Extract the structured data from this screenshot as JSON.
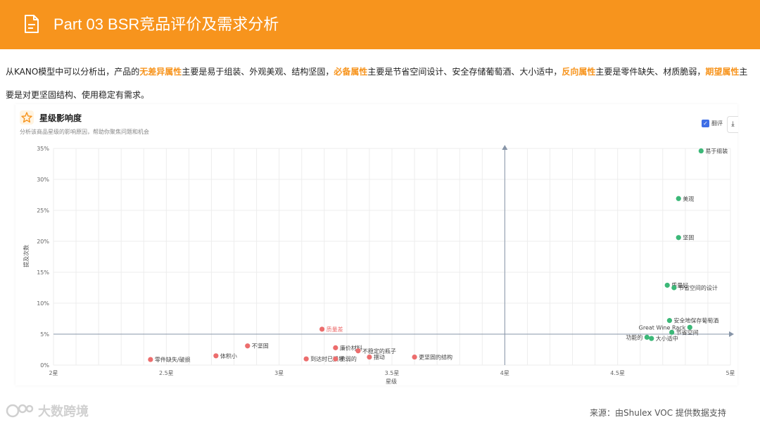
{
  "header": {
    "title": "Part 03  BSR竞品评价及需求分析"
  },
  "description": {
    "p1": "从KANO模型中可以分析出，产品的",
    "h1": "无差异属性",
    "p2": "主要是易于组装、外观美观、结构坚固，",
    "h2": "必备属性",
    "p3": "主要是节省空间设计、安全存储葡萄酒、大小适中，",
    "h3": "反向属性",
    "p4": "主要是零件缺失、材质脆弱，",
    "h4": "期望属性",
    "p5": "主要是对更坚固结构、使用稳定有需求。"
  },
  "panel": {
    "title": "星级影响度",
    "subtitle": "分析该商品星级的影响原因，帮助你聚焦问题和机会",
    "toggle_label": "翻评",
    "star_icon": "star-icon",
    "download_icon": "download-icon"
  },
  "chart_data": {
    "type": "scatter",
    "xlabel": "星级",
    "ylabel": "提及次数",
    "xlim": [
      2,
      5
    ],
    "ylim": [
      0,
      35
    ],
    "x_ticks": [
      "2星",
      "2.5星",
      "3星",
      "3.5星",
      "4星",
      "4.5星",
      "5星"
    ],
    "y_ticks": [
      "0%",
      "5%",
      "10%",
      "15%",
      "20%",
      "25%",
      "30%",
      "35%"
    ],
    "quadrant_center": {
      "x": 4,
      "y": 5
    },
    "colors": {
      "positive": "#3cb878",
      "negative": "#ec6d6d"
    },
    "points": [
      {
        "label": "易于组装",
        "x": 4.87,
        "y": 34.6,
        "group": "positive"
      },
      {
        "label": "美观",
        "x": 4.77,
        "y": 26.9,
        "group": "positive"
      },
      {
        "label": "坚固",
        "x": 4.77,
        "y": 20.6,
        "group": "positive"
      },
      {
        "label": "质量好",
        "x": 4.72,
        "y": 12.9,
        "group": "positive"
      },
      {
        "label": "节省空间的设计",
        "x": 4.75,
        "y": 12.5,
        "group": "positive"
      },
      {
        "label": "安全地保存葡萄酒",
        "x": 4.73,
        "y": 7.2,
        "group": "positive"
      },
      {
        "label": "Great Wine Rack",
        "x": 4.82,
        "y": 6.1,
        "group": "positive"
      },
      {
        "label": "节省空间",
        "x": 4.74,
        "y": 5.3,
        "group": "positive"
      },
      {
        "label": "功能的",
        "x": 4.63,
        "y": 4.5,
        "group": "positive"
      },
      {
        "label": "大小适中",
        "x": 4.65,
        "y": 4.3,
        "group": "positive"
      },
      {
        "label": "质量差",
        "x": 3.19,
        "y": 5.8,
        "group": "negative"
      },
      {
        "label": "不坚固",
        "x": 2.86,
        "y": 3.1,
        "group": "negative"
      },
      {
        "label": "体积小",
        "x": 2.72,
        "y": 1.5,
        "group": "negative"
      },
      {
        "label": "零件缺失/破损",
        "x": 2.43,
        "y": 0.9,
        "group": "negative"
      },
      {
        "label": "到达时已损坏",
        "x": 3.12,
        "y": 1.0,
        "group": "negative"
      },
      {
        "label": "廉价材料",
        "x": 3.25,
        "y": 2.8,
        "group": "negative"
      },
      {
        "label": "不稳定的瓶子",
        "x": 3.35,
        "y": 2.3,
        "group": "negative"
      },
      {
        "label": "脆弱的",
        "x": 3.25,
        "y": 1.0,
        "group": "negative"
      },
      {
        "label": "摆动",
        "x": 3.4,
        "y": 1.3,
        "group": "negative"
      },
      {
        "label": "更坚固的结构",
        "x": 3.6,
        "y": 1.3,
        "group": "negative"
      }
    ]
  },
  "watermark": "大数跨境",
  "source": "来源：由Shulex VOC 提供数据支持"
}
